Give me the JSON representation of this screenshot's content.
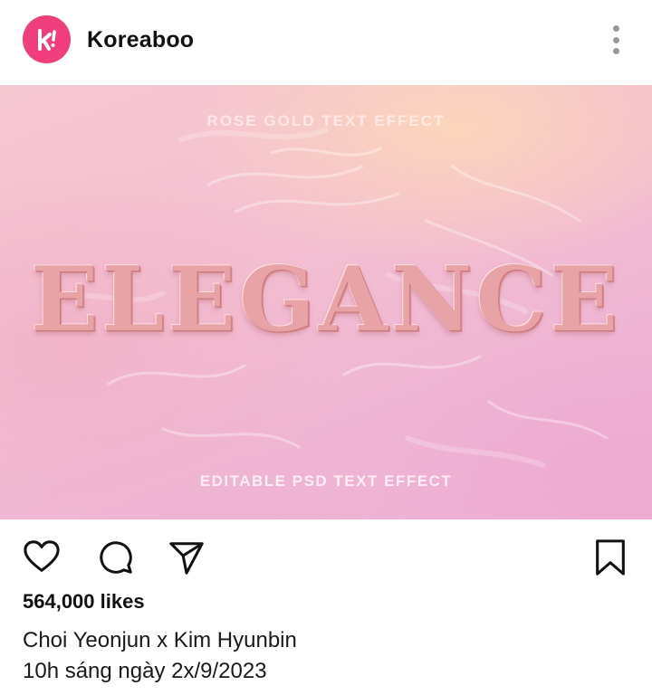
{
  "header": {
    "account_name": "Koreaboo",
    "avatar_icon": "koreaboo-logo-icon",
    "more_icon": "more-vertical-icon",
    "brand_color": "#ef3e7b"
  },
  "post_image": {
    "top_text": "ROSE GOLD TEXT EFFECT",
    "main_text": "ELEGANCE",
    "bottom_text": "EDITABLE PSD TEXT EFFECT"
  },
  "actions": {
    "like_icon": "heart-icon",
    "comment_icon": "comment-icon",
    "share_icon": "send-icon",
    "save_icon": "bookmark-icon"
  },
  "likes": "564,000 likes",
  "caption": {
    "line1": "Choi Yeonjun x Kim Hyunbin",
    "line2": "10h sáng ngày 2x/9/2023"
  }
}
